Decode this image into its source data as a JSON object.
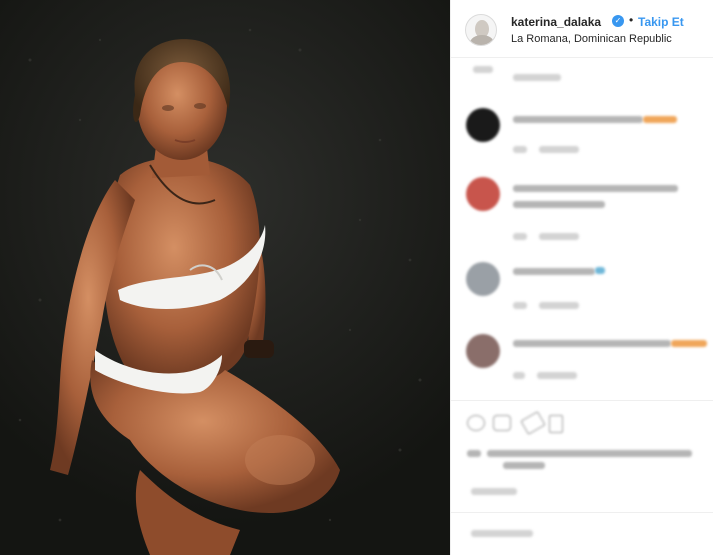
{
  "post": {
    "photo_alt": "Woman in white bikini crouching on wet grass"
  },
  "header": {
    "username": "katerina_dalaka",
    "verified_icon": "verified-badge-icon",
    "separator": "•",
    "follow_label": "Takip Et",
    "location": "La Romana, Dominican Republic"
  },
  "comments": [
    {
      "avatar_color": "#1a1a1a"
    },
    {
      "avatar_color": "#c8554c"
    },
    {
      "avatar_color": "#9aa0a6"
    },
    {
      "avatar_color": "#8a6e6a"
    }
  ],
  "colors": {
    "accent": "#3897f0",
    "username": "#262626",
    "border": "#efefef"
  }
}
